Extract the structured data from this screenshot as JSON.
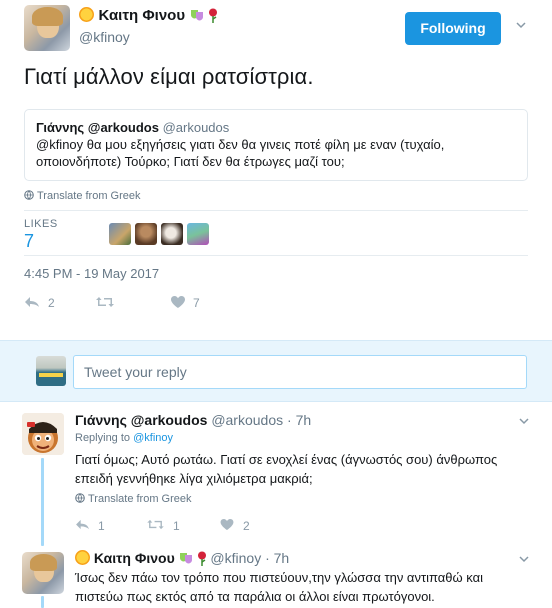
{
  "tweet": {
    "author_name": "Καιτη Φινου",
    "author_handle": "@kfinoy",
    "follow_label": "Following",
    "text": "Γιατί μάλλον είμαι ρατσίστρια.",
    "quote": {
      "name": "Γιάννης @arkoudos",
      "handle": "@arkoudos",
      "text_line1": "@kfinoy θα μου εξηγήσεις γιατι δεν θα γινεις ποτέ φίλη με εναν (τυχαίο,",
      "text_line2": "οποιονδήποτε) Τούρκο; Γιατί δεν θα έτρωγες μαζί του;"
    },
    "translate_label": "Translate from Greek",
    "likes_label": "LIKES",
    "likes_count": "7",
    "timestamp": "4:45 PM - 19 May 2017",
    "reply_count": "2",
    "retweet_count": "",
    "like_count": "7"
  },
  "reply_box": {
    "placeholder": "Tweet your reply"
  },
  "replies": [
    {
      "name": "Γιάννης @arkoudos",
      "handle": "@arkoudos",
      "time": "· 7h",
      "replying_prefix": "Replying to",
      "replying_to": "@kfinoy",
      "line1": "Γιατί όμως; Αυτό ρωτάω. Γιατί σε ενοχλεί ένας (άγνωστός σου) άνθρωπος",
      "line2": "επειδή γεννήθηκε λίγα χιλιόμετρα μακριά;",
      "translate_label": "Translate from Greek",
      "reply_count": "1",
      "retweet_count": "1",
      "like_count": "2"
    },
    {
      "name": "Καιτη Φινου",
      "handle": "@kfinoy",
      "time": "· 7h",
      "line1": "Ίσως δεν πάω τον τρόπο που πιστεύουν,την γλώσσα την αντιπαθώ και",
      "line2": "πιστεύω πως εκτός από τα παράλια οι άλλοι είναι πρωτόγονοι."
    }
  ],
  "colors": {
    "accent": "#1b95e0",
    "muted": "#657786",
    "reply_band": "#e8f5fd",
    "thread_line": "#a4d9f9"
  }
}
